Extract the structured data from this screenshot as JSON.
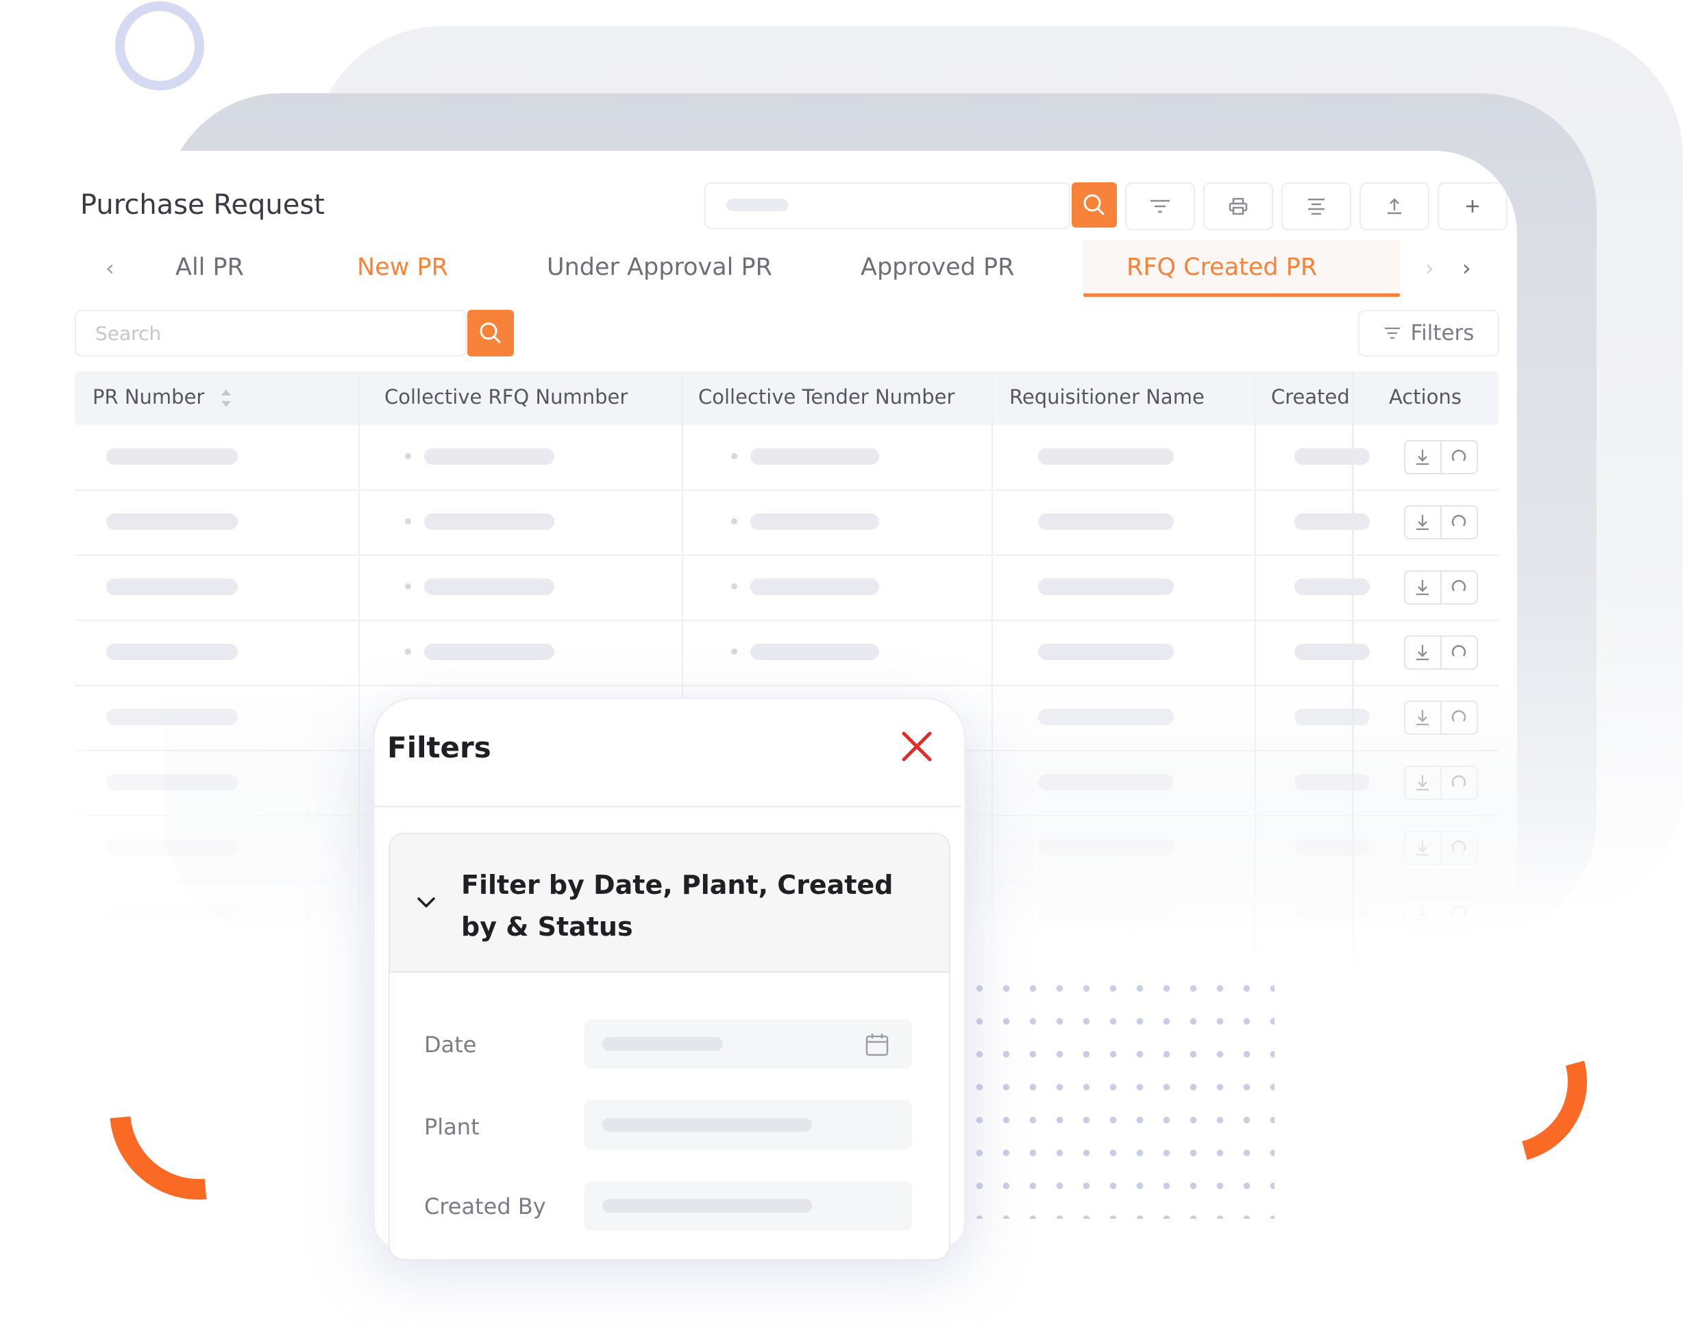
{
  "app": {
    "title": "Purchase Request",
    "toolbar": {
      "search_icon": "search-icon",
      "buttons": [
        "filter-icon",
        "print-icon",
        "align-icon",
        "upload-icon",
        "plus-icon"
      ]
    },
    "tabs": [
      {
        "label": "All PR",
        "state": "normal"
      },
      {
        "label": "New PR",
        "state": "highlight"
      },
      {
        "label": "Under Approval PR",
        "state": "normal"
      },
      {
        "label": "Approved PR",
        "state": "normal"
      },
      {
        "label": "RFQ Created PR",
        "state": "active"
      }
    ],
    "search": {
      "placeholder": "Search"
    },
    "filters_button": {
      "label": "Filters"
    },
    "table": {
      "columns": [
        "PR Number",
        "Collective RFQ Numnber",
        "Collective Tender Number",
        "Requisitioner Name",
        "Created",
        "Actions"
      ]
    }
  },
  "filters_popup": {
    "title": "Filters",
    "section_title": "Filter by Date, Plant, Created by & Status",
    "fields": [
      {
        "label": "Date"
      },
      {
        "label": "Plant"
      },
      {
        "label": "Created By"
      }
    ]
  },
  "colors": {
    "accent": "#f7833a",
    "close": "#e22b2b",
    "decor_orange": "#fb6a25",
    "decor_ring": "#d5daf2"
  }
}
